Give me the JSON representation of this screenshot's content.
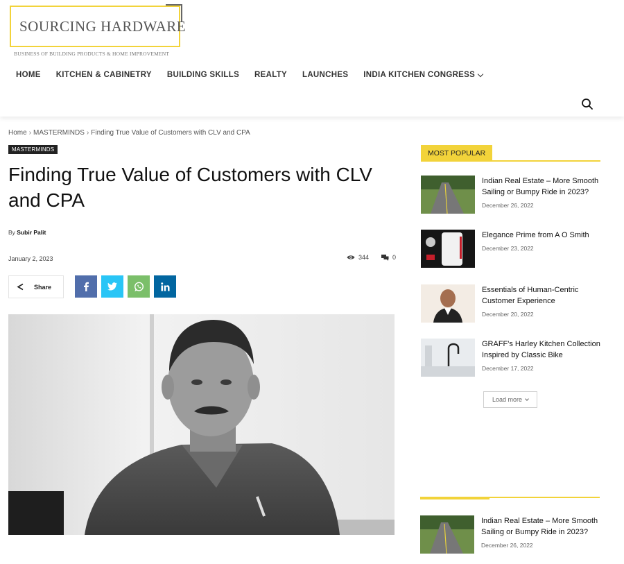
{
  "logo": {
    "title": "SOURCING HARDWARE",
    "subtitle": "BUSINESS OF BUILDING PRODUCTS & HOME IMPROVEMENT"
  },
  "nav": {
    "items": [
      {
        "label": "HOME"
      },
      {
        "label": "KITCHEN & CABINETRY"
      },
      {
        "label": "BUILDING SKILLS"
      },
      {
        "label": "REALTY"
      },
      {
        "label": "LAUNCHES"
      },
      {
        "label": "INDIA KITCHEN CONGRESS"
      }
    ]
  },
  "breadcrumb": {
    "home": "Home",
    "category": "MASTERMINDS",
    "current": "Finding True Value of Customers with CLV and CPA",
    "separator": "›"
  },
  "article": {
    "category_badge": "MASTERMINDS",
    "title": "Finding True Value of Customers with CLV and CPA",
    "by_prefix": "By",
    "author": "Subir Palit",
    "date": "January 2, 2023",
    "views": "344",
    "comments": "0",
    "share_label": "Share"
  },
  "sidebar": {
    "most_popular_label": "MOST POPULAR",
    "posts": [
      {
        "title": "Indian Real Estate – More Smooth Sailing or Bumpy Ride in 2023?",
        "date": "December 26, 2022"
      },
      {
        "title": "Elegance Prime from A O Smith",
        "date": "December 23, 2022"
      },
      {
        "title": "Essentials of Human-Centric Customer Experience",
        "date": "December 20, 2022"
      },
      {
        "title": "GRAFF's Harley Kitchen Collection Inspired by Classic Bike",
        "date": "December 17, 2022"
      }
    ],
    "load_more": "Load more",
    "bottom_post": {
      "title": "Indian Real Estate – More Smooth Sailing or Bumpy Ride in 2023?",
      "date": "December 26, 2022"
    }
  },
  "colors": {
    "accent": "#f2d33a",
    "facebook": "#516eab",
    "twitter": "#29c5f6",
    "whatsapp": "#7bbf6a",
    "linkedin": "#0266a0"
  },
  "icons": [
    "search-icon",
    "chevron-down-icon",
    "eye-icon",
    "comment-icon",
    "share-icon",
    "facebook-icon",
    "twitter-icon",
    "whatsapp-icon",
    "linkedin-icon"
  ]
}
